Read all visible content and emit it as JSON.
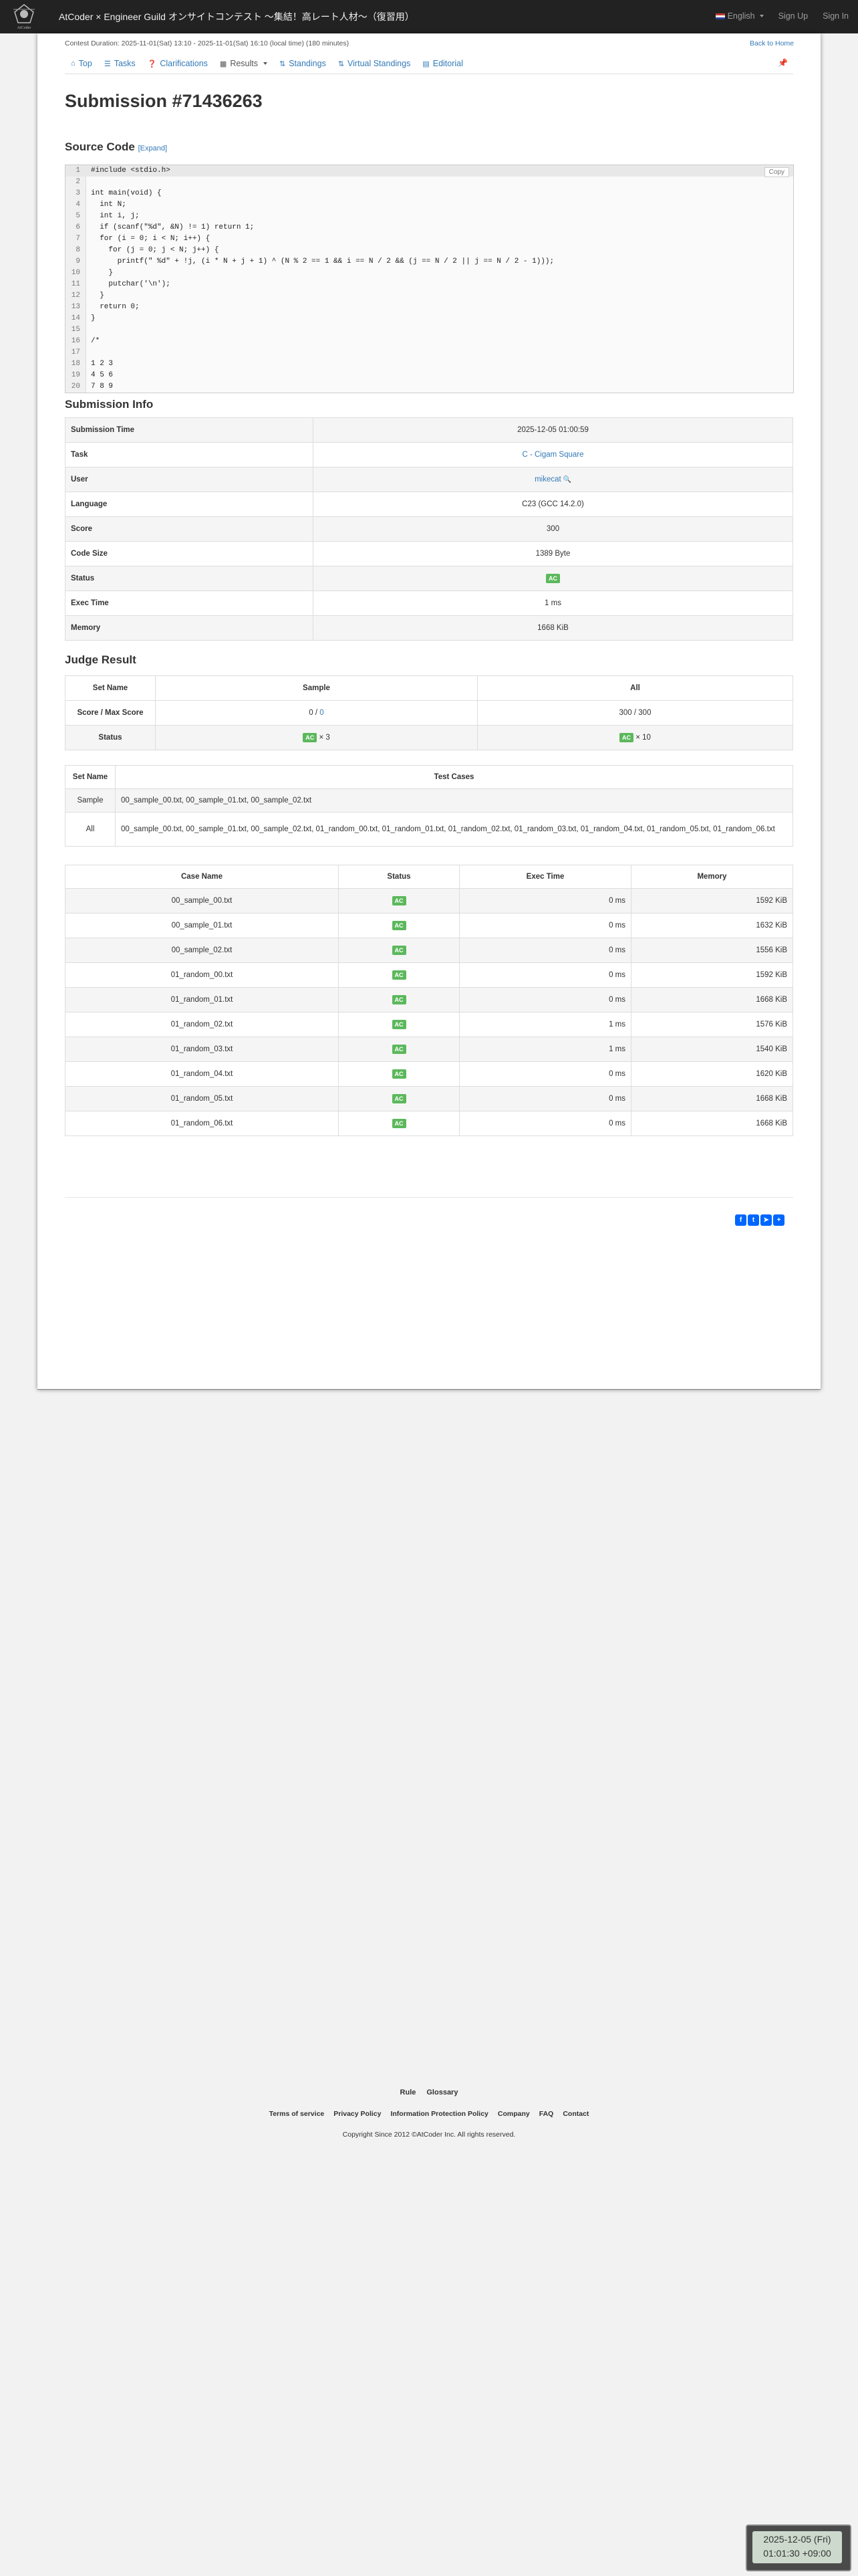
{
  "navbar": {
    "brand": "AtCoder × Engineer Guild オンサイトコンテスト ～集結！高レート人材～（復習用）",
    "language": "English",
    "sign_up": "Sign Up",
    "sign_in": "Sign In",
    "logo_text": "AtCoder"
  },
  "contest": {
    "duration": "Contest Duration: 2025-11-01(Sat) 13:10 - 2025-11-01(Sat) 16:10 (local time) (180 minutes)",
    "back_home": "Back to Home"
  },
  "tabs": [
    {
      "label": "Top",
      "icon": "home-icon"
    },
    {
      "label": "Tasks",
      "icon": "list-icon"
    },
    {
      "label": "Clarifications",
      "icon": "question-icon"
    },
    {
      "label": "Results",
      "icon": "table-icon"
    },
    {
      "label": "Standings",
      "icon": "sort-icon"
    },
    {
      "label": "Virtual Standings",
      "icon": "sort-icon"
    },
    {
      "label": "Editorial",
      "icon": "book-icon"
    }
  ],
  "page": {
    "title": "Submission #71436263",
    "source_heading": "Source Code",
    "expand": "[Expand]",
    "copy": "Copy",
    "info_heading": "Submission Info",
    "judge_heading": "Judge Result"
  },
  "code_lines": [
    "#include <stdio.h>",
    "",
    "int main(void) {",
    "  int N;",
    "  int i, j;",
    "  if (scanf(\"%d\", &N) != 1) return 1;",
    "  for (i = 0; i < N; i++) {",
    "    for (j = 0; j < N; j++) {",
    "      printf(\" %d\" + !j, (i * N + j + 1) ^ (N % 2 == 1 && i == N / 2 && (j == N / 2 || j == N / 2 - 1)));",
    "    }",
    "    putchar('\\n');",
    "  }",
    "  return 0;",
    "}",
    "",
    "/*",
    "",
    "1 2 3",
    "4 5 6",
    "7 8 9"
  ],
  "submission_info": [
    {
      "key": "Submission Time",
      "value": "2025-12-05 01:00:59"
    },
    {
      "key": "Task",
      "value": "C - Cigam Square",
      "link": true
    },
    {
      "key": "User",
      "value": "mikecat",
      "link": true
    },
    {
      "key": "Language",
      "value": "C23 (GCC 14.2.0)"
    },
    {
      "key": "Score",
      "value": "300"
    },
    {
      "key": "Code Size",
      "value": "1389 Byte"
    },
    {
      "key": "Status",
      "value": "AC",
      "badge": true
    },
    {
      "key": "Exec Time",
      "value": "1 ms"
    },
    {
      "key": "Memory",
      "value": "1668 KiB"
    }
  ],
  "judge": {
    "headers": [
      "Set Name",
      "Sample",
      "All"
    ],
    "score_label": "Score / Max Score",
    "sample_score": "0",
    "sample_max": "0",
    "all_score": "300 / 300",
    "status_label": "Status",
    "sample_status": "AC",
    "sample_count": "× 3",
    "all_status": "AC",
    "all_count": "× 10"
  },
  "sets": {
    "headers": [
      "Set Name",
      "Test Cases"
    ],
    "rows": [
      {
        "name": "Sample",
        "cases": "00_sample_00.txt, 00_sample_01.txt, 00_sample_02.txt"
      },
      {
        "name": "All",
        "cases": "00_sample_00.txt, 00_sample_01.txt, 00_sample_02.txt, 01_random_00.txt, 01_random_01.txt, 01_random_02.txt, 01_random_03.txt, 01_random_04.txt, 01_random_05.txt, 01_random_06.txt"
      }
    ]
  },
  "cases": {
    "headers": [
      "Case Name",
      "Status",
      "Exec Time",
      "Memory"
    ],
    "rows": [
      {
        "name": "00_sample_00.txt",
        "status": "AC",
        "time": "0 ms",
        "memory": "1592 KiB"
      },
      {
        "name": "00_sample_01.txt",
        "status": "AC",
        "time": "0 ms",
        "memory": "1632 KiB"
      },
      {
        "name": "00_sample_02.txt",
        "status": "AC",
        "time": "0 ms",
        "memory": "1556 KiB"
      },
      {
        "name": "01_random_00.txt",
        "status": "AC",
        "time": "0 ms",
        "memory": "1592 KiB"
      },
      {
        "name": "01_random_01.txt",
        "status": "AC",
        "time": "0 ms",
        "memory": "1668 KiB"
      },
      {
        "name": "01_random_02.txt",
        "status": "AC",
        "time": "1 ms",
        "memory": "1576 KiB"
      },
      {
        "name": "01_random_03.txt",
        "status": "AC",
        "time": "1 ms",
        "memory": "1540 KiB"
      },
      {
        "name": "01_random_04.txt",
        "status": "AC",
        "time": "0 ms",
        "memory": "1620 KiB"
      },
      {
        "name": "01_random_05.txt",
        "status": "AC",
        "time": "0 ms",
        "memory": "1668 KiB"
      },
      {
        "name": "01_random_06.txt",
        "status": "AC",
        "time": "0 ms",
        "memory": "1668 KiB"
      }
    ]
  },
  "footer": {
    "links1": [
      "Rule",
      "Glossary"
    ],
    "links2": [
      "Terms of service",
      "Privacy Policy",
      "Information Protection Policy",
      "Company",
      "FAQ",
      "Contact"
    ],
    "copyright": "Copyright Since 2012 ©AtCoder Inc. All rights reserved."
  },
  "clock": {
    "date": "2025-12-05 (Fri)",
    "time": "01:01:30 +09:00"
  },
  "colors": {
    "navbar": "#222222",
    "link": "#337ab7",
    "ac_badge": "#5cb85c",
    "share": "#0166ff"
  }
}
